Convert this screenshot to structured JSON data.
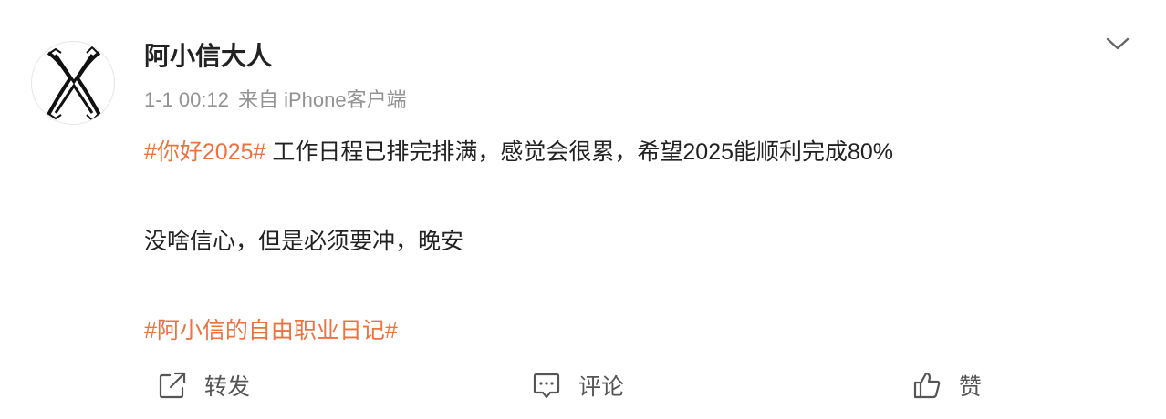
{
  "post": {
    "author": "阿小信大人",
    "time": "1-1 00:12",
    "source": "来自 iPhone客户端",
    "topic1": "#你好2025#",
    "line1_text": " 工作日程已排完排满，感觉会很累，希望2025能顺利完成80%",
    "line2_text": "没啥信心，但是必须要冲，晚安",
    "topic2": "#阿小信的自由职业日记#"
  },
  "actions": {
    "repost_label": "转发",
    "comment_label": "评论",
    "like_label": "赞"
  },
  "icons": {
    "avatar": "x-logo-avatar",
    "menu": "chevron-down-icon",
    "repost": "repost-icon",
    "comment": "comment-icon",
    "like": "thumbs-up-icon"
  },
  "colors": {
    "topic": "#eb7340",
    "meta": "#939393",
    "text": "#222222",
    "icon": "#555555"
  }
}
